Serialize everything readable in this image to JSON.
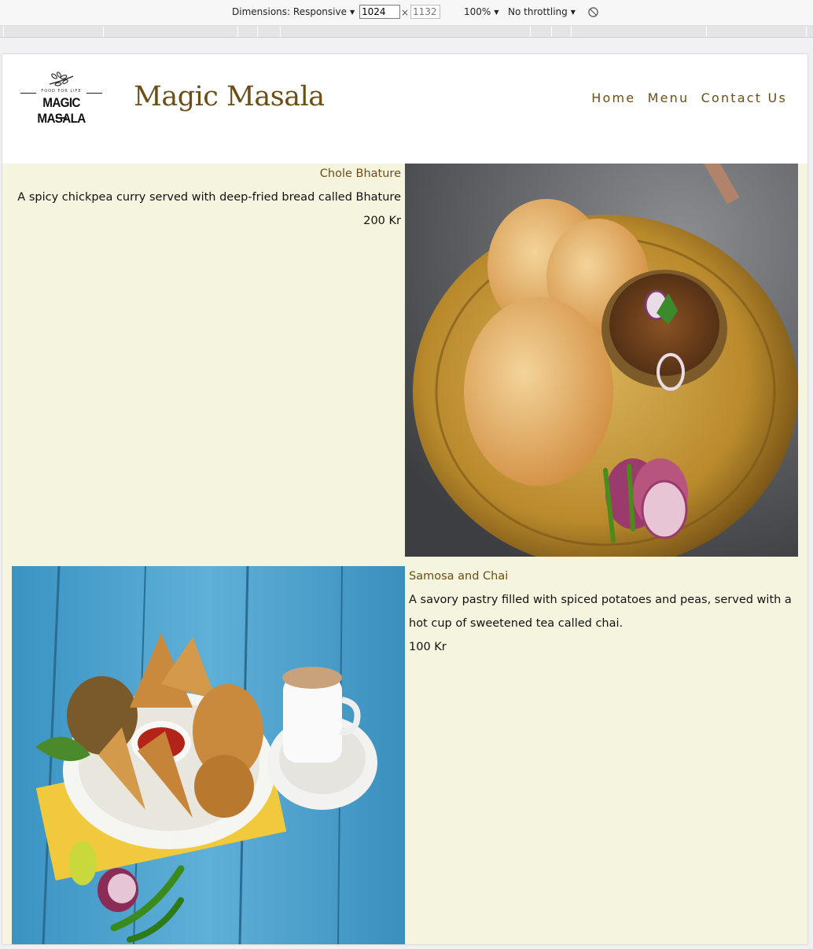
{
  "devtools": {
    "dimensions_label": "Dimensions: Responsive",
    "width_value": "1024",
    "height_placeholder": "1132",
    "times": "×",
    "zoom": "100%",
    "throttling": "No throttling"
  },
  "site": {
    "logo": {
      "tagline": "FOOD FOR LIFE",
      "name": "MAGIC MASALA"
    },
    "brand_title": "Magic Masala",
    "nav": [
      "Home",
      "Menu",
      "Contact Us"
    ]
  },
  "menu": [
    {
      "name": "Chole Bhature",
      "description": "A spicy chickpea curry served with deep-fried bread called Bhature",
      "price": "200 Kr",
      "image_icon": "chole-bhature-photo"
    },
    {
      "name": "Samosa and Chai",
      "description": "A savory pastry filled with spiced potatoes and peas, served with a hot cup of sweetened tea called chai.",
      "price": "100 Kr",
      "image_icon": "samosa-chai-photo"
    }
  ],
  "colors": {
    "brand": "#6b4e16",
    "content_bg": "#f5f5df"
  }
}
